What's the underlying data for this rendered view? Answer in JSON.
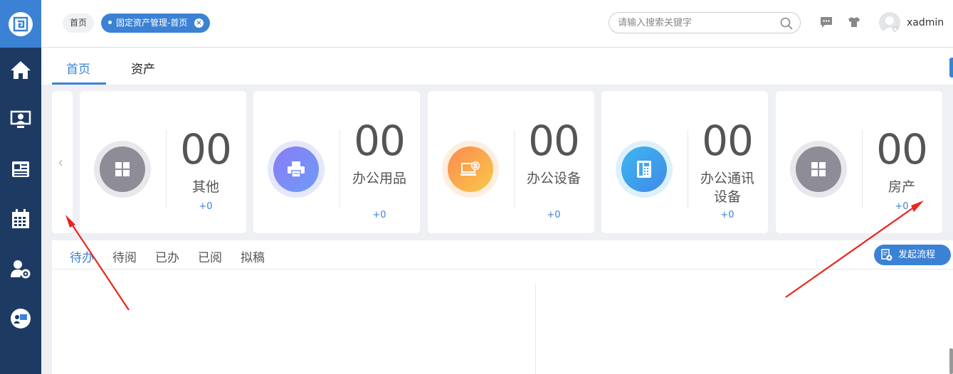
{
  "header": {
    "breadcrumb_home": "首页",
    "breadcrumb_active": "固定资产管理-首页",
    "search_placeholder": "请输入搜索关键字",
    "username": "xadmin"
  },
  "tabs": [
    {
      "label": "首页",
      "active": true
    },
    {
      "label": "资产",
      "active": false
    }
  ],
  "cards": [
    {
      "count": "00",
      "name": "其他",
      "delta": "+0",
      "icon": "grid-icon"
    },
    {
      "count": "00",
      "name": "办公用品",
      "delta": "+0",
      "icon": "printer-icon"
    },
    {
      "count": "00",
      "name": "办公设备",
      "delta": "+0",
      "icon": "computer-globe-icon"
    },
    {
      "count": "00",
      "name": "办公通讯设备",
      "delta": "+0",
      "icon": "telephone-icon"
    },
    {
      "count": "00",
      "name": "房产",
      "delta": "+0",
      "icon": "grid-icon"
    }
  ],
  "workflow": {
    "tabs": [
      "待办",
      "待阅",
      "已办",
      "已阅",
      "拟稿"
    ],
    "start_button": "发起流程"
  },
  "colors": {
    "sidebar": "#1d3a63",
    "accent": "#3b82d4",
    "annotation_arrow": "#e8261c"
  }
}
